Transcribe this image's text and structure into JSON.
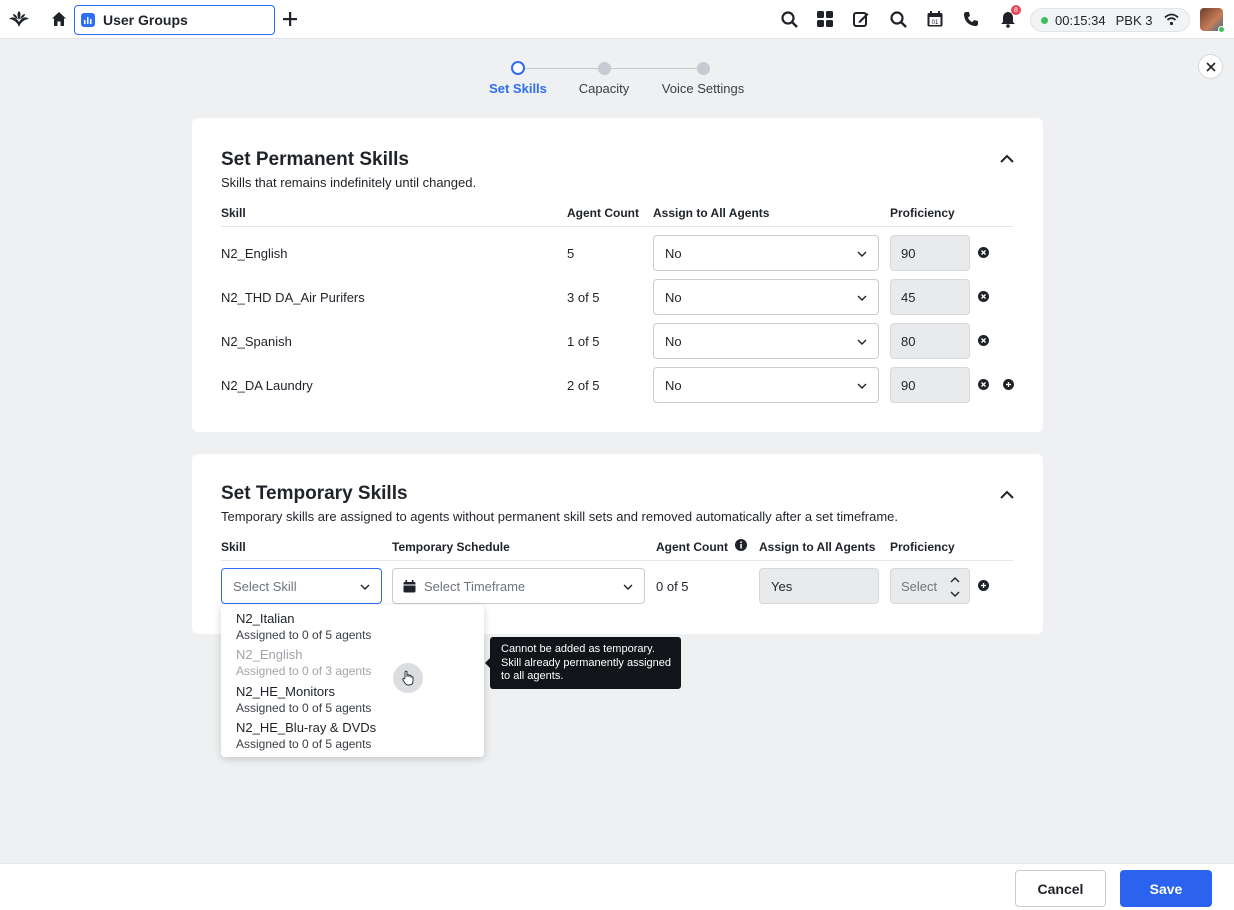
{
  "topbar": {
    "tab_title": "User Groups",
    "timer": "00:15:34",
    "station": "PBK 3",
    "notification_count": "8",
    "icons": [
      "brand-logo-icon",
      "home-icon",
      "chart-icon",
      "plus-icon",
      "search-icon",
      "apps-grid-icon",
      "compose-icon",
      "search-alt-icon",
      "calendar-icon",
      "phone-icon",
      "bell-icon",
      "wifi-icon"
    ]
  },
  "stepper": {
    "steps": [
      {
        "label": "Set Skills"
      },
      {
        "label": "Capacity"
      },
      {
        "label": "Voice Settings"
      }
    ]
  },
  "permanent": {
    "title": "Set Permanent Skills",
    "subtitle": "Skills that remains indefinitely until changed.",
    "headers": {
      "skill": "Skill",
      "agent_count": "Agent Count",
      "assign": "Assign to All Agents",
      "proficiency": "Proficiency"
    },
    "rows": [
      {
        "skill": "N2_English",
        "agent_count": "5",
        "assign": "No",
        "proficiency": "90"
      },
      {
        "skill": "N2_THD DA_Air Purifers",
        "agent_count": "3 of 5",
        "assign": "No",
        "proficiency": "45"
      },
      {
        "skill": "N2_Spanish",
        "agent_count": "1 of 5",
        "assign": "No",
        "proficiency": "80"
      },
      {
        "skill": "N2_DA Laundry",
        "agent_count": "2 of 5",
        "assign": "No",
        "proficiency": "90"
      }
    ]
  },
  "temporary": {
    "title": "Set Temporary Skills",
    "subtitle": "Temporary skills are assigned to agents without permanent skill sets and removed automatically after a set timeframe.",
    "headers": {
      "skill": "Skill",
      "schedule": "Temporary Schedule",
      "agent_count": "Agent Count",
      "assign": "Assign to All Agents",
      "proficiency": "Proficiency"
    },
    "row": {
      "skill_placeholder": "Select Skill",
      "schedule_placeholder": "Select Timeframe",
      "agent_count": "0 of 5",
      "assign": "Yes",
      "proficiency_placeholder": "Select"
    },
    "dropdown": [
      {
        "name": "N2_Italian",
        "sub": "Assigned to 0 of 5 agents",
        "disabled": false
      },
      {
        "name": "N2_English",
        "sub": "Assigned to 0 of 3 agents",
        "disabled": true
      },
      {
        "name": "N2_HE_Monitors",
        "sub": "Assigned to 0 of 5 agents",
        "disabled": false
      },
      {
        "name": "N2_HE_Blu-ray & DVDs",
        "sub": "Assigned to 0 of 5 agents",
        "disabled": false
      }
    ],
    "tooltip": "Cannot be added as temporary. Skill already permanently assigned to all agents."
  },
  "footer": {
    "cancel": "Cancel",
    "save": "Save"
  },
  "colors": {
    "accent": "#2f6df4",
    "save_button": "#2b63ef",
    "online": "#3fbf5a",
    "badge": "#e6455a"
  }
}
